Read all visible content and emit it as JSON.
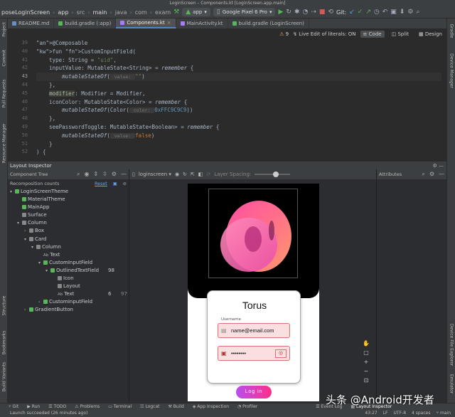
{
  "window_title": "LoginScreen – Components.kt [LoginScreen.app.main]",
  "breadcrumbs": [
    "poseLoginScreen",
    "app",
    "src",
    "main",
    "java",
    "com",
    "exam"
  ],
  "toolbar": {
    "run_config": "app",
    "device": "Google Pixel 6 Pro",
    "git_label": "Git:"
  },
  "left_stripe": [
    "Project",
    "Commit",
    "Pull Requests",
    "Resource Manager",
    "Structure",
    "Bookmarks",
    "Build Variants"
  ],
  "right_stripe": [
    "Gradle",
    "Device Manager",
    "Device File Explorer",
    "Emulator"
  ],
  "file_tabs": [
    {
      "label": "README.md",
      "color": "#6a8fc7",
      "active": false
    },
    {
      "label": "build.gradle (:app)",
      "color": "#58b65b",
      "active": false
    },
    {
      "label": "Components.kt",
      "color": "#a97bff",
      "active": true
    },
    {
      "label": "MainActivity.kt",
      "color": "#a97bff",
      "active": false
    },
    {
      "label": "build.gradle (LoginScreen)",
      "color": "#58b65b",
      "active": false
    }
  ],
  "editor": {
    "live_edit": "Live Edit of literals: ON",
    "view_code": "Code",
    "view_split": "Split",
    "view_design": "Design",
    "warnings": "9",
    "line_numbers": [
      "39",
      "40",
      "41",
      "42",
      "43",
      "44",
      "45",
      "46",
      "47",
      "48",
      "49",
      "50",
      "51",
      "52"
    ],
    "current_line": "43",
    "lines": [
      {
        "t": "@Composable",
        "k": "an"
      },
      {
        "t": "fun CustomInputField(",
        "k": "fun"
      },
      {
        "t": "    type: String = \"uid\",",
        "k": "param"
      },
      {
        "t": "    inputValue: MutableState<String> = remember {",
        "k": "param"
      },
      {
        "t": "        mutableStateOf( value: \"\")",
        "k": "state"
      },
      {
        "t": "    },",
        "k": "plain"
      },
      {
        "t": "    modifier: Modifier = Modifier,",
        "k": "param"
      },
      {
        "t": "    iconColor: MutableState<Color> = remember {",
        "k": "param"
      },
      {
        "t": "        mutableStateOf(Color( color: 0xFFC9C9C9))",
        "k": "state"
      },
      {
        "t": "    },",
        "k": "plain"
      },
      {
        "t": "    seePasswordToggle: MutableState<Boolean> = remember {",
        "k": "param"
      },
      {
        "t": "        mutableStateOf( value: false)",
        "k": "state"
      },
      {
        "t": "    }",
        "k": "plain"
      },
      {
        "t": ") {",
        "k": "plain"
      }
    ]
  },
  "layout_inspector": {
    "title": "Layout Inspector",
    "component_tree_label": "Component Tree",
    "recomposition_label": "Recomposition counts",
    "reset_label": "Reset",
    "process": "loginscreen",
    "layer_spacing": "Layer Spacing:",
    "attributes_label": "Attributes",
    "tree": [
      {
        "label": "LoginScreenTheme",
        "depth": 0,
        "arrow": "▾",
        "icon": "#58b65b",
        "c1": "",
        "c2": ""
      },
      {
        "label": "MaterialTheme",
        "depth": 1,
        "arrow": "",
        "icon": "#58b65b",
        "c1": "",
        "c2": ""
      },
      {
        "label": "MainApp",
        "depth": 1,
        "arrow": "",
        "icon": "#58b65b",
        "c1": "",
        "c2": ""
      },
      {
        "label": "Surface",
        "depth": 1,
        "arrow": "",
        "icon": "#888888",
        "c1": "",
        "c2": ""
      },
      {
        "label": "Column",
        "depth": 1,
        "arrow": "▾",
        "icon": "#888888",
        "c1": "",
        "c2": ""
      },
      {
        "label": "Box",
        "depth": 2,
        "arrow": "›",
        "icon": "#888888",
        "c1": "",
        "c2": ""
      },
      {
        "label": "Card",
        "depth": 2,
        "arrow": "▾",
        "icon": "#888888",
        "c1": "",
        "c2": ""
      },
      {
        "label": "Column",
        "depth": 3,
        "arrow": "▾",
        "icon": "#888888",
        "c1": "",
        "c2": ""
      },
      {
        "label": "Text",
        "depth": 4,
        "arrow": "",
        "icon": "ab",
        "c1": "",
        "c2": ""
      },
      {
        "label": "CustomInputField",
        "depth": 4,
        "arrow": "▾",
        "icon": "#58b65b",
        "c1": "",
        "c2": ""
      },
      {
        "label": "OutlinedTextField",
        "depth": 5,
        "arrow": "▾",
        "icon": "#58b65b",
        "c1": "98",
        "c2": ""
      },
      {
        "label": "Icon",
        "depth": 6,
        "arrow": "",
        "icon": "#888888",
        "c1": "",
        "c2": ""
      },
      {
        "label": "Layout",
        "depth": 6,
        "arrow": "",
        "icon": "#888888",
        "c1": "",
        "c2": ""
      },
      {
        "label": "Text",
        "depth": 6,
        "arrow": "",
        "icon": "ab",
        "c1": "6",
        "c2": "97"
      },
      {
        "label": "CustomInputField",
        "depth": 4,
        "arrow": "›",
        "icon": "#58b65b",
        "c1": "",
        "c2": ""
      },
      {
        "label": "GradientButton",
        "depth": 2,
        "arrow": "›",
        "icon": "#58b65b",
        "c1": "",
        "c2": ""
      }
    ]
  },
  "device_preview": {
    "card_title": "Torus",
    "username_label": "Username",
    "username_value": "name@email.com",
    "password_value": "••••••••",
    "login_button": "Log in",
    "gradient_start": "#b84ff0",
    "gradient_end": "#ff2e8a"
  },
  "bottom_tools": [
    "Git",
    "Run",
    "TODO",
    "Problems",
    "Terminal",
    "Logcat",
    "Build",
    "App Inspection",
    "Profiler",
    "Event Log",
    "Layout Inspector"
  ],
  "statusbar": {
    "message": "Launch succeeded (26 minutes ago)",
    "position": "43:27",
    "line_sep": "LF",
    "encoding": "UTF-8",
    "indent": "4 spaces",
    "branch": "main"
  },
  "watermark": "头条 @Android开发者"
}
